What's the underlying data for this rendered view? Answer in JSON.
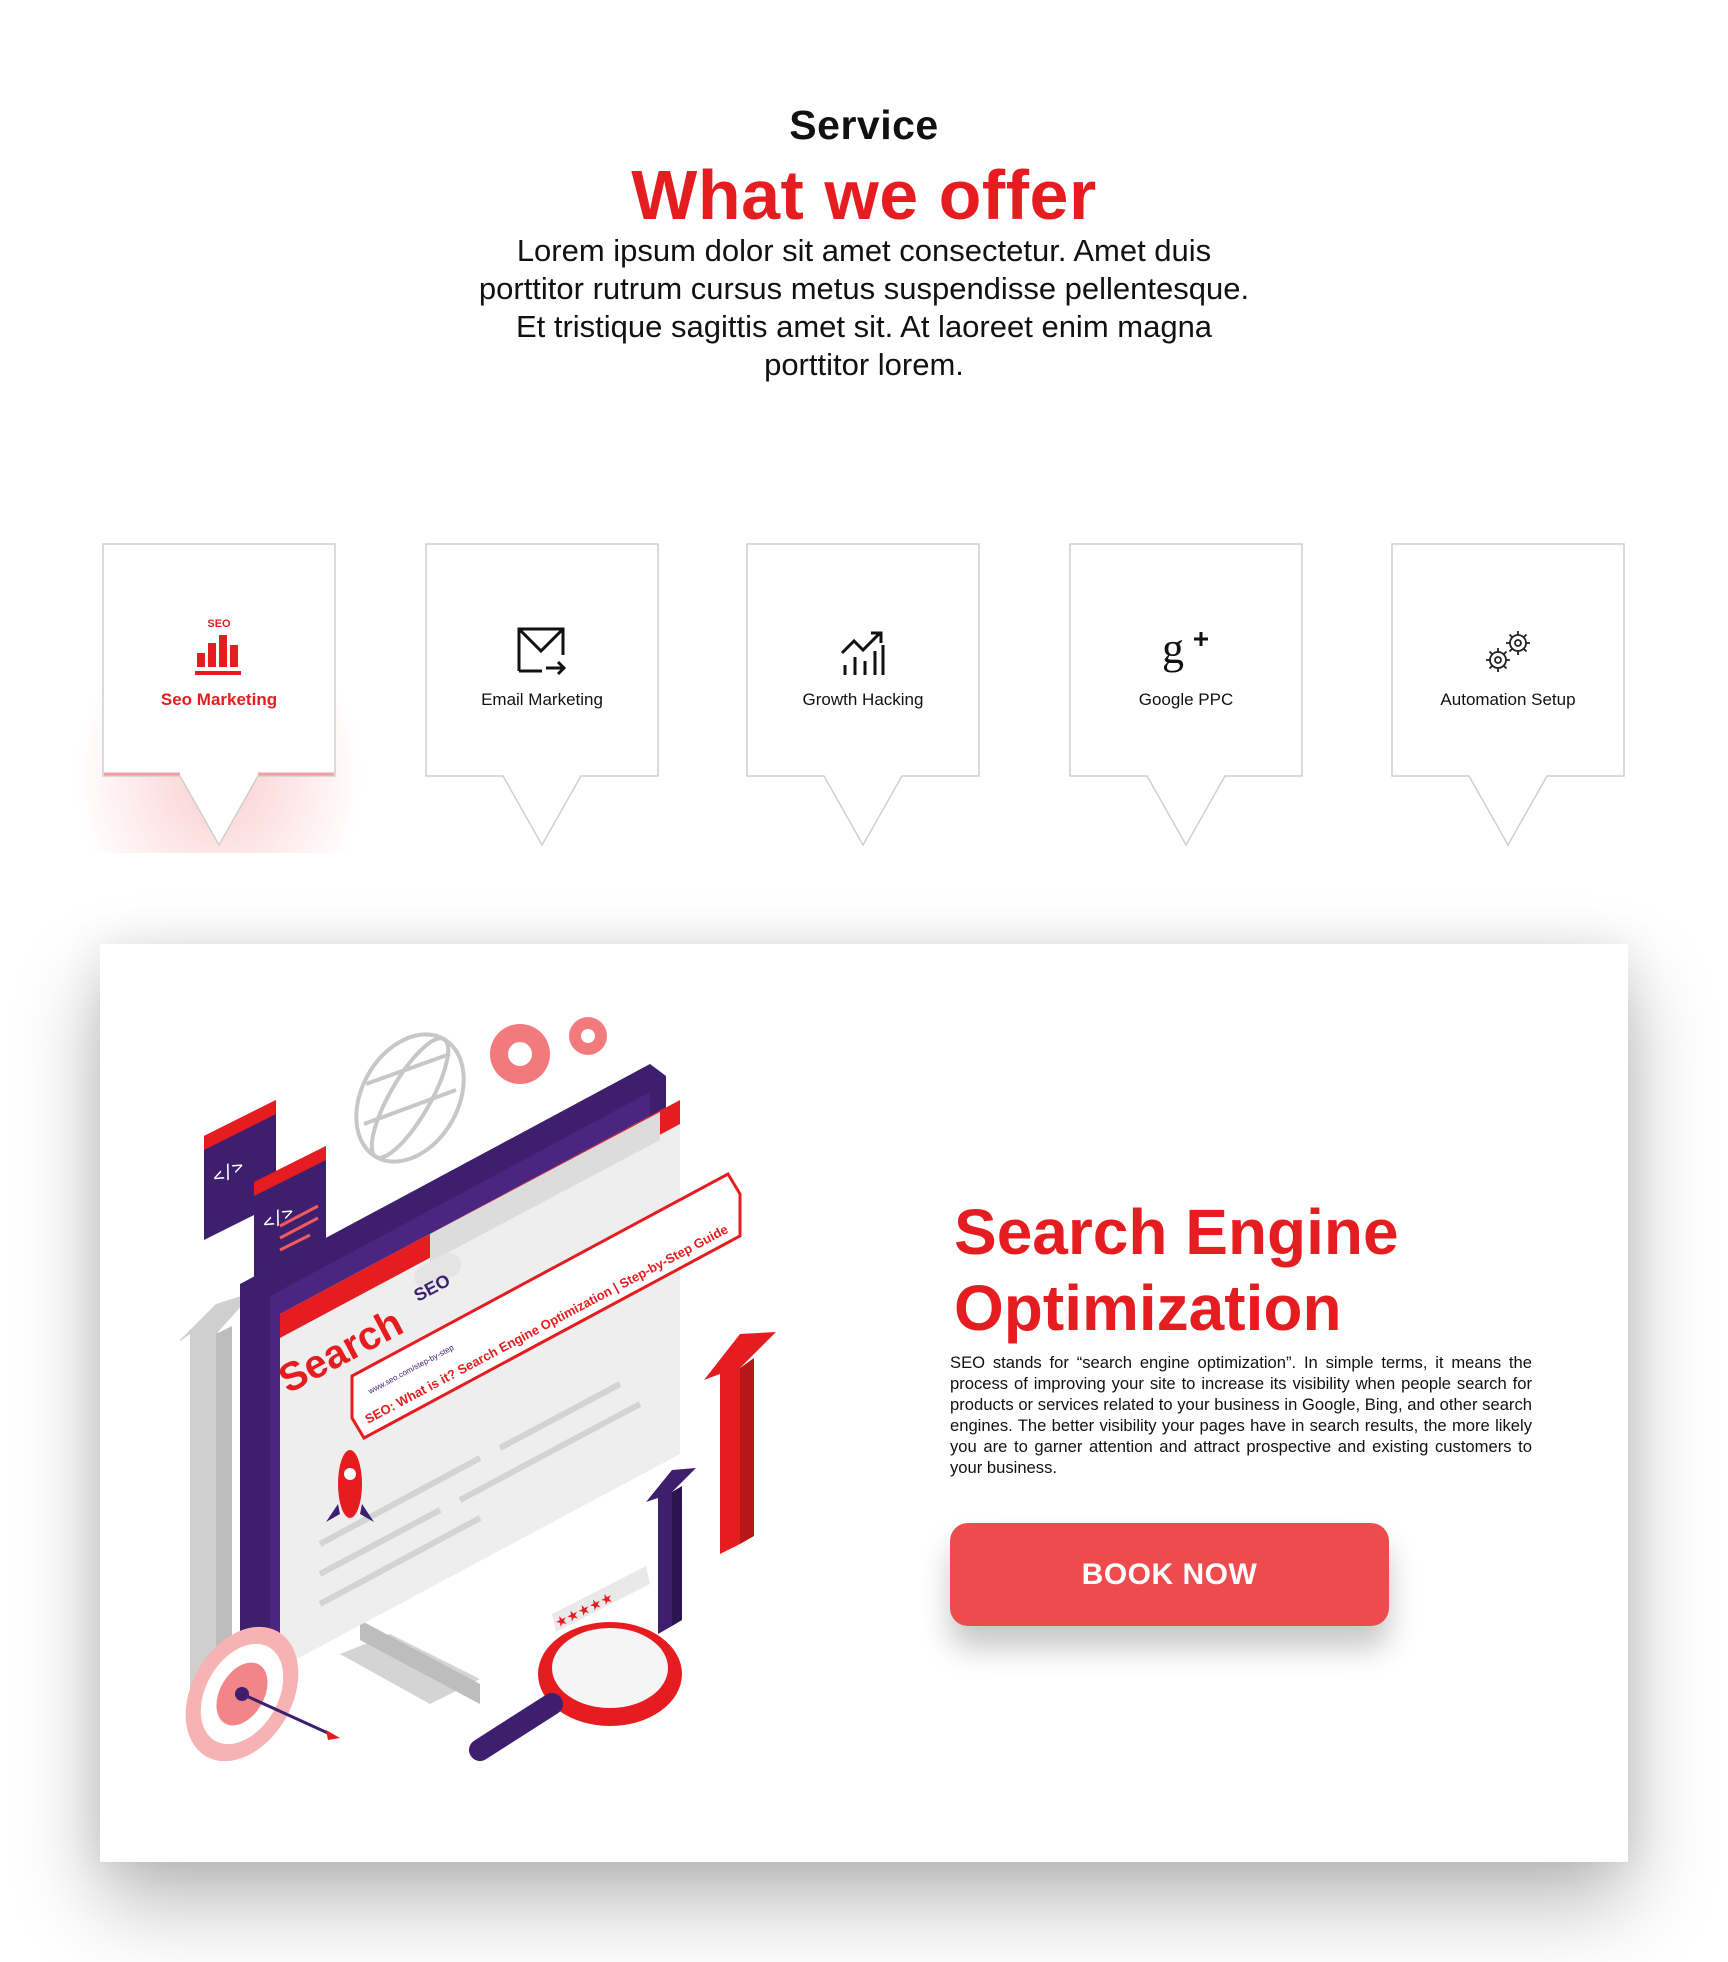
{
  "header": {
    "eyebrow": "Service",
    "title": "What we offer",
    "intro": "Lorem ipsum dolor sit amet consectetur. Amet duis porttitor rutrum cursus metus suspendisse pellentesque. Et tristique sagittis amet sit. At laoreet enim magna porttitor lorem."
  },
  "services": [
    {
      "label": "Seo Marketing",
      "icon": "seo-bar-chart-icon",
      "active": true,
      "icon_caption": "SEO"
    },
    {
      "label": "Email Marketing",
      "icon": "email-forward-icon",
      "active": false
    },
    {
      "label": "Growth Hacking",
      "icon": "growth-chart-icon",
      "active": false
    },
    {
      "label": "Google PPC",
      "icon": "google-plus-icon",
      "active": false
    },
    {
      "label": "Automation Setup",
      "icon": "gears-icon",
      "active": false
    }
  ],
  "detail": {
    "title_line1": "Search Engine",
    "title_line2": "Optimization",
    "text": "SEO stands for “search engine optimization”. In simple terms, it means the process of improving your site to increase its visibility when people search for products or services related to your business in Google, Bing, and other search engines. The better visibility your pages have in search results, the more likely you are to garner attention and attract prospective and existing customers to your business.",
    "button_label": "BOOK NOW",
    "illustration": {
      "search_word": "Search",
      "seo_tag": "SEO",
      "url": "www.seo.com/step-by-step",
      "result_title": "SEO: What is it? Search Engine Optimization | Step-by-Step Guide"
    }
  },
  "colors": {
    "accent": "#e51d20",
    "button": "#ee4b4f",
    "purple": "#3d1f6e"
  }
}
